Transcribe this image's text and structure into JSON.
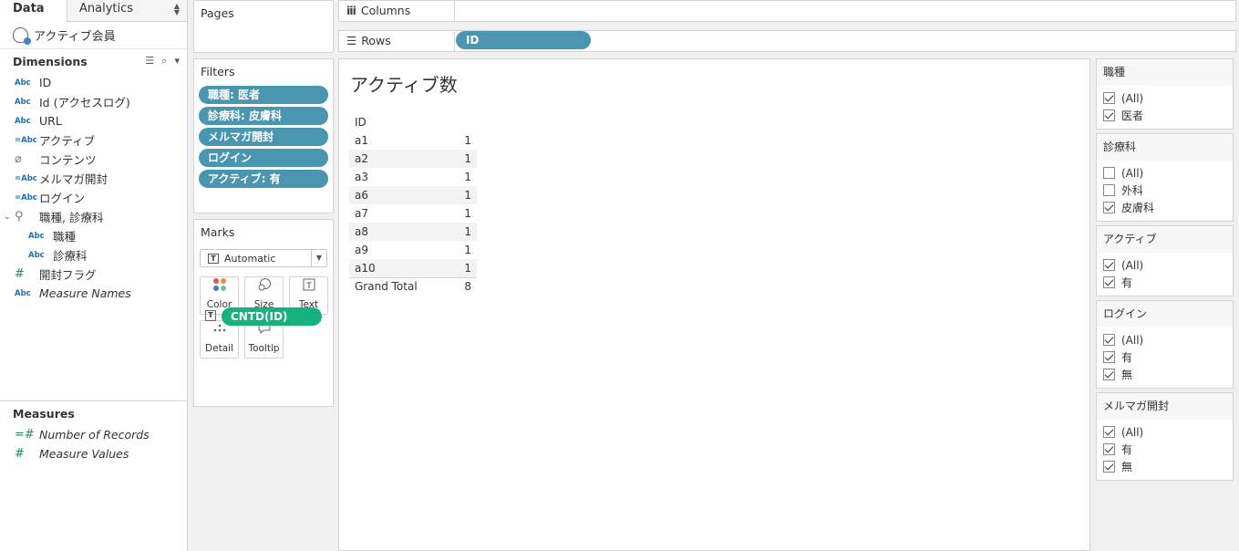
{
  "data_pane": {
    "tabs": [
      {
        "label": "Data"
      },
      {
        "label": "Analytics"
      }
    ],
    "datasource": "アクティブ会員",
    "dimensions_label": "Dimensions",
    "dimensions": [
      {
        "type": "Abc",
        "label": "ID"
      },
      {
        "type": "Abc",
        "label": "Id (アクセスログ)"
      },
      {
        "type": "Abc",
        "label": "URL"
      },
      {
        "type": "=Abc",
        "label": "アクティブ"
      },
      {
        "type": "clip",
        "label": "コンテンツ"
      },
      {
        "type": "=Abc",
        "label": "メルマガ開封"
      },
      {
        "type": "=Abc",
        "label": "ログイン"
      },
      {
        "type": "hierarchy",
        "label": "職種, 診療科"
      },
      {
        "type": "Abc",
        "label": "職種"
      },
      {
        "type": "Abc",
        "label": "診療科"
      },
      {
        "type": "#",
        "label": "開封フラグ"
      },
      {
        "type": "Abc",
        "label": "Measure Names"
      }
    ],
    "measures_label": "Measures",
    "measures": [
      {
        "type": "=#",
        "label": "Number of Records"
      },
      {
        "type": "#",
        "label": "Measure Values"
      }
    ]
  },
  "pages": {
    "title": "Pages"
  },
  "filters": {
    "title": "Filters",
    "pills": [
      "職種: 医者",
      "診療科: 皮膚科",
      "メルマガ開封",
      "ログイン",
      "アクティブ: 有"
    ]
  },
  "marks": {
    "title": "Marks",
    "type_select": "Automatic",
    "type_icon_glyph": "T",
    "buttons": [
      {
        "label": "Color",
        "icon": "color-icon"
      },
      {
        "label": "Size",
        "icon": "size-icon"
      },
      {
        "label": "Text",
        "icon": "text-icon"
      },
      {
        "label": "Detail",
        "icon": "detail-icon"
      },
      {
        "label": "Tooltip",
        "icon": "tooltip-icon"
      }
    ],
    "field_pill": "CNTD(ID)"
  },
  "shelves": {
    "columns_label": "Columns",
    "rows_label": "Rows",
    "rows_pill": "ID"
  },
  "view": {
    "title": "アクティブ数",
    "header": "ID",
    "rows": [
      {
        "id": "a1",
        "value": "1"
      },
      {
        "id": "a2",
        "value": "1"
      },
      {
        "id": "a3",
        "value": "1"
      },
      {
        "id": "a6",
        "value": "1"
      },
      {
        "id": "a7",
        "value": "1"
      },
      {
        "id": "a8",
        "value": "1"
      },
      {
        "id": "a9",
        "value": "1"
      },
      {
        "id": "a10",
        "value": "1"
      }
    ],
    "total": {
      "label": "Grand Total",
      "value": "8"
    }
  },
  "filter_cards": [
    {
      "title": "職種",
      "items": [
        {
          "label": "(All)",
          "checked": true
        },
        {
          "label": "医者",
          "checked": true
        }
      ]
    },
    {
      "title": "診療科",
      "items": [
        {
          "label": "(All)",
          "checked": false
        },
        {
          "label": "外科",
          "checked": false
        },
        {
          "label": "皮膚科",
          "checked": true
        }
      ]
    },
    {
      "title": "アクティブ",
      "items": [
        {
          "label": "(All)",
          "checked": true
        },
        {
          "label": "有",
          "checked": true
        }
      ]
    },
    {
      "title": "ログイン",
      "items": [
        {
          "label": "(All)",
          "checked": true
        },
        {
          "label": "有",
          "checked": true
        },
        {
          "label": "無",
          "checked": true
        }
      ]
    },
    {
      "title": "メルマガ開封",
      "items": [
        {
          "label": "(All)",
          "checked": true
        },
        {
          "label": "有",
          "checked": true
        },
        {
          "label": "無",
          "checked": true
        }
      ]
    }
  ],
  "colors": {
    "dimension_pill": "#4a96b0",
    "measure_pill": "#16b17e",
    "dimension_icon": "#1f6fb0",
    "measure_icon": "#1c8a73"
  }
}
